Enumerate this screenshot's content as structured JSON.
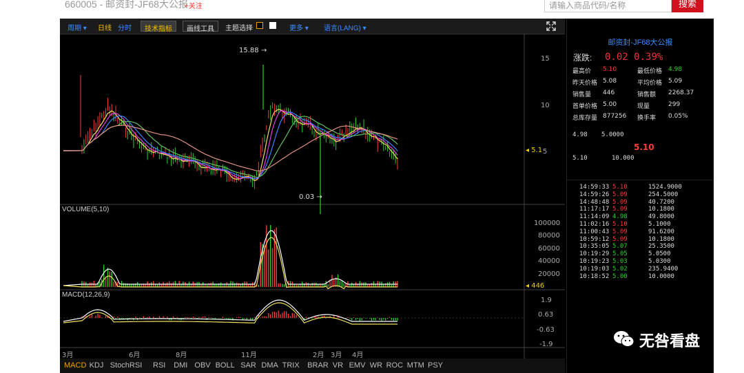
{
  "header": {
    "code_title": "660005 - 邮资封-JF68大公报",
    "follow_label": "+关注",
    "search_placeholder": "请输入商品代码/名称",
    "search_button": "搜索"
  },
  "toolbar": {
    "period": "周期 ▾",
    "day_line": "日线",
    "time_share": "分时",
    "tech_indicators": "技术指标",
    "draw_tools": "画线工具",
    "theme": "主题选择",
    "more": "更多 ▾",
    "language": "语言(LANG) ▾"
  },
  "price_axis": {
    "ticks": [
      "15",
      "10",
      "5"
    ],
    "current": "5.1"
  },
  "annotations": {
    "high": "15.88",
    "low": "0.03"
  },
  "volume_panel": {
    "label": "VOLUME(5,10)",
    "ticks": [
      "100000",
      "80000",
      "60000",
      "40000",
      "20000"
    ],
    "current": "446"
  },
  "macd_panel": {
    "label": "MACD(12,26,9)",
    "ticks": [
      "1.9",
      "0.63",
      "-0.63",
      "-1.9"
    ]
  },
  "x_axis": [
    "3月",
    "6月",
    "8月",
    "11月",
    "2月",
    "3月",
    "4月"
  ],
  "indicator_tabs": [
    "MACD",
    "KDJ",
    "StochRSI",
    "RSI",
    "DMI",
    "OBV",
    "BOLL",
    "SAR",
    "DMA",
    "TRIX",
    "BRAR",
    "VR",
    "EMV",
    "WR",
    "ROC",
    "MTM",
    "PSY"
  ],
  "quote": {
    "title": "邮资封-JF68大公报",
    "change_label": "涨跌:",
    "change": "0.02",
    "change_pct": "0.39%",
    "high_label": "最高价",
    "high": "5.10",
    "low_label": "最低价格",
    "low": "4.98",
    "prev_label": "昨天价格",
    "prev": "5.08",
    "avg_label": "平均价格",
    "avg": "5.09",
    "vol_label": "销售量",
    "vol": "446",
    "amount_label": "销售额",
    "amount": "2268.37",
    "open_label": "首单价格",
    "open": "5.00",
    "cur_vol_label": "现量",
    "cur_vol": "299",
    "stock_label": "总库存量",
    "stock": "877256",
    "turnover_label": "换手率",
    "turnover": "0.05%"
  },
  "order_book": {
    "sell_price": "4.98",
    "sell_qty": "5.0000",
    "last": "5.10",
    "buy_price": "5.10",
    "buy_qty": "10.000"
  },
  "trades": [
    {
      "time": "14:59:33",
      "price": "5.10",
      "dir": "up",
      "qty": "1524.9000"
    },
    {
      "time": "14:59:26",
      "price": "5.09",
      "dir": "up",
      "qty": "254.5000"
    },
    {
      "time": "14:48:48",
      "price": "5.09",
      "dir": "up",
      "qty": "40.7200"
    },
    {
      "time": "11:17:17",
      "price": "5.09",
      "dir": "up",
      "qty": "10.1800"
    },
    {
      "time": "11:14:09",
      "price": "4.98",
      "dir": "down",
      "qty": "49.8000"
    },
    {
      "time": "11:02:16",
      "price": "5.10",
      "dir": "up",
      "qty": "5.1000"
    },
    {
      "time": "11:00:43",
      "price": "5.09",
      "dir": "up",
      "qty": "91.6200"
    },
    {
      "time": "10:59:12",
      "price": "5.09",
      "dir": "up",
      "qty": "10.1800"
    },
    {
      "time": "10:35:05",
      "price": "5.07",
      "dir": "down",
      "qty": "25.3500"
    },
    {
      "time": "10:19:29",
      "price": "5.05",
      "dir": "down",
      "qty": "5.0500"
    },
    {
      "time": "10:19:23",
      "price": "5.03",
      "dir": "down",
      "qty": "5.0300"
    },
    {
      "time": "10:19:03",
      "price": "5.02",
      "dir": "down",
      "qty": "235.9400"
    },
    {
      "time": "10:18:52",
      "price": "5.00",
      "dir": "down",
      "qty": "10.0000"
    }
  ],
  "watermark": "无咎看盘",
  "colors": {
    "up": "#ff3b3b",
    "down": "#2bd02b",
    "accent": "#3b8cff",
    "ma_yellow": "#f0e060",
    "ma_pink": "#e040e0",
    "ma_blue": "#4080ff",
    "ma_green": "#60c060",
    "ma_salmon": "#e09080"
  }
}
